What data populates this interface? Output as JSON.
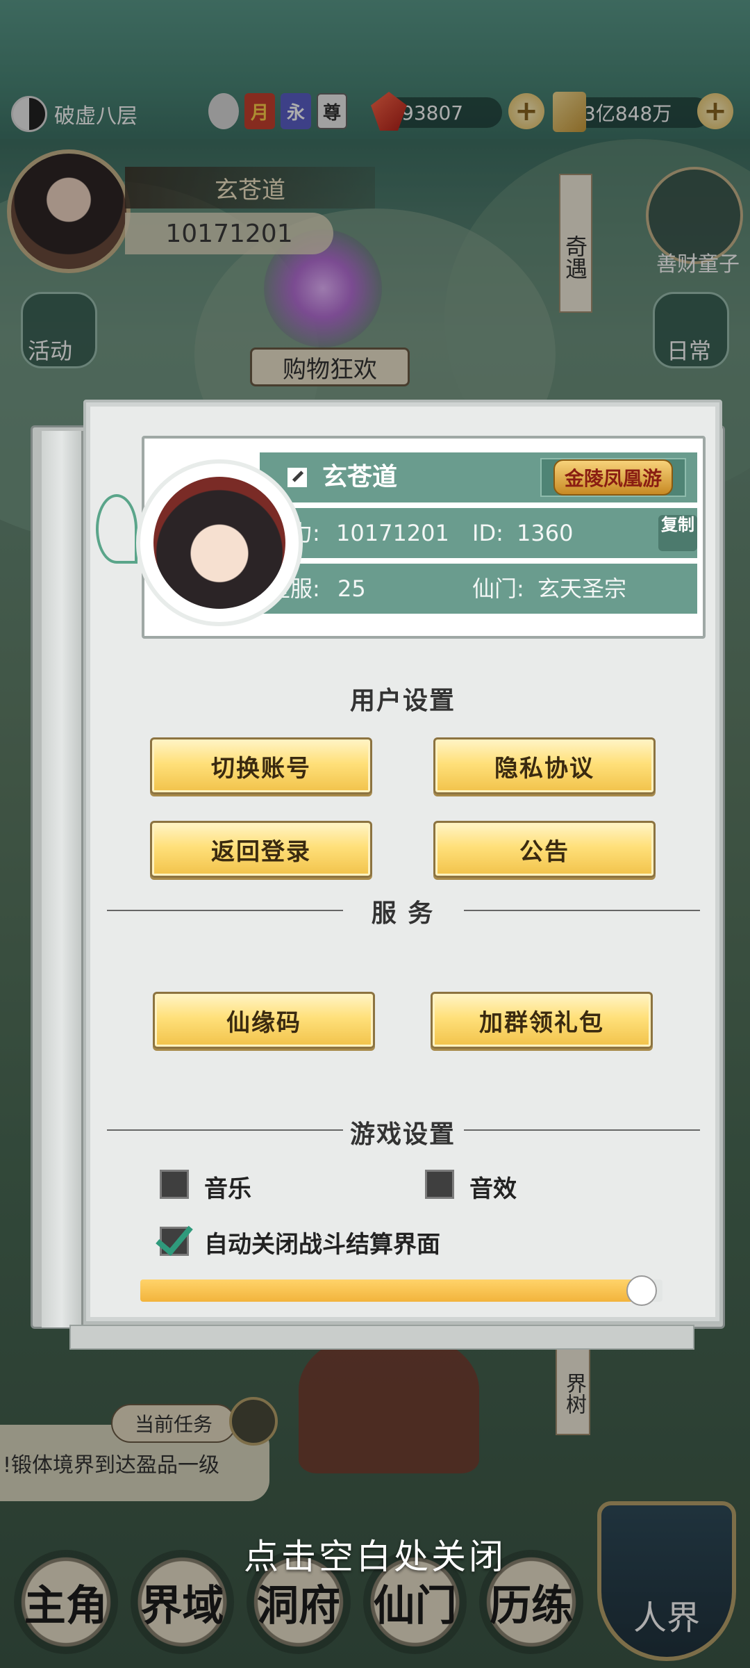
{
  "top_bar": {
    "realm_label": "破虚八层",
    "badges": [
      "",
      "月",
      "永",
      "尊"
    ],
    "jade_amount": "93807",
    "coin_amount": "3亿848万"
  },
  "hud": {
    "player_name": "玄苍道",
    "power": "10171201",
    "side_event": "奇遇",
    "right_label": "善财童子",
    "left_icon_label": "活动",
    "right_icon_label": "日常",
    "shop_banner": "购物狂欢",
    "tree_label": "界树",
    "task_tab": "当前任务",
    "task_text": "!锻体境界到达盈品一级",
    "close_hint": "点击空白处关闭",
    "nav": [
      "主角",
      "界域",
      "洞府",
      "仙门",
      "历练"
    ],
    "realm_button": "人界"
  },
  "profile": {
    "name": "玄苍道",
    "title_badge": "金陵凤凰游",
    "power_label": "战力:",
    "power_value": "10171201",
    "id_label": "ID:",
    "id_value": "1360",
    "copy_label": "复制",
    "server_label": "区服:",
    "server_value": "25",
    "sect_label": "仙门:",
    "sect_value": "玄天圣宗"
  },
  "user_settings": {
    "title": "用户设置",
    "switch_account": "切换账号",
    "privacy": "隐私协议",
    "back_login": "返回登录",
    "notice": "公告"
  },
  "services": {
    "title": "服 务",
    "xianyuan_code": "仙缘码",
    "join_group": "加群领礼包"
  },
  "game_settings": {
    "title": "游戏设置",
    "music_label": "音乐",
    "music_checked": false,
    "sfx_label": "音效",
    "sfx_checked": false,
    "auto_close_label": "自动关闭战斗结算界面",
    "auto_close_checked": true,
    "slider_fraction": 0.96
  }
}
